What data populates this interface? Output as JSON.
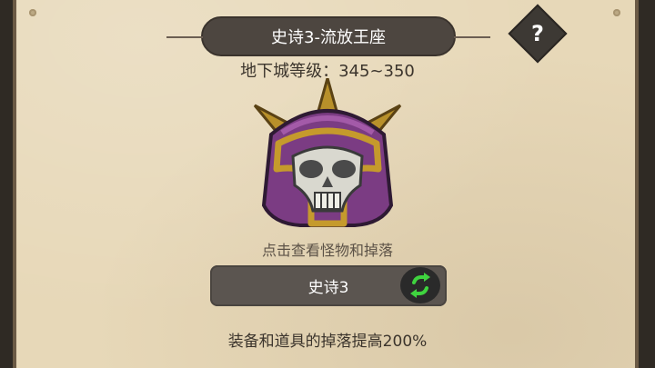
{
  "header": {
    "title": "史诗3-流放王座",
    "help_label": "?"
  },
  "dungeon": {
    "level_text": "地下城等级：345~350",
    "boss_icon": "purple-skull-helmet-icon"
  },
  "hint_text": "点击查看怪物和掉落",
  "difficulty": {
    "selected_label": "史诗3",
    "swap_icon": "swap-arrows-icon"
  },
  "bonus_text": "装备和道具的掉落提高200%",
  "colors": {
    "parchment": "#e7d8b8",
    "banner": "#4d4640",
    "accent_green": "#3fd43f",
    "helmet_purple": "#7b3c83",
    "helmet_gold": "#c59a2c"
  }
}
